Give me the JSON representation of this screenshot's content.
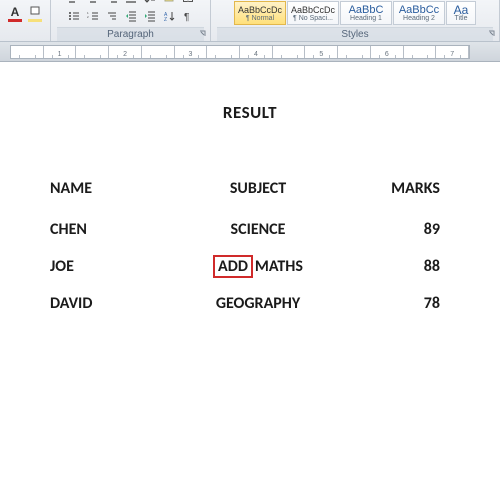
{
  "ribbon": {
    "paragraph": {
      "label": "Paragraph"
    },
    "styles": {
      "label": "Styles",
      "items": [
        {
          "preview": "AaBbCcDc",
          "name": "¶ Normal"
        },
        {
          "preview": "AaBbCcDc",
          "name": "¶ No Spaci..."
        },
        {
          "preview": "AaBbC",
          "name": "Heading 1"
        },
        {
          "preview": "AaBbCc",
          "name": "Heading 2"
        },
        {
          "preview": "Aa",
          "name": "Title"
        }
      ]
    }
  },
  "ruler": {
    "numbers": [
      "",
      "1",
      "",
      "2",
      "",
      "3",
      "",
      "4",
      "",
      "5",
      "",
      "6",
      "",
      "7"
    ]
  },
  "doc": {
    "title": "RESULT",
    "headers": {
      "name": "NAME",
      "subject": "SUBJECT",
      "marks": "MARKS"
    },
    "rows": [
      {
        "name": "CHEN",
        "subject": "SCIENCE",
        "marks": "89"
      },
      {
        "name": "JOE",
        "subject_pre": "ADD",
        "subject_post": "MATHS",
        "marks": "88"
      },
      {
        "name": "DAVID",
        "subject": "GEOGRAPHY",
        "marks": "78"
      }
    ]
  }
}
